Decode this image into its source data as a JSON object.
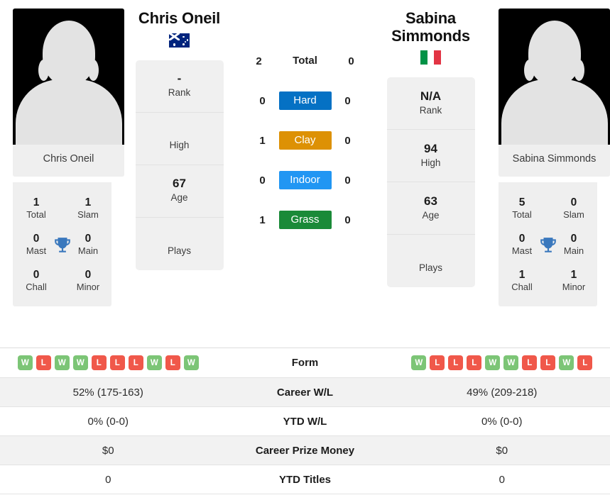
{
  "players": {
    "left": {
      "name": "Chris Oneil",
      "photo_caption": "Chris Oneil",
      "country": "Australia",
      "flag_icon": "flag-australia-icon",
      "info_cards": [
        {
          "value": "-",
          "label": "Rank"
        },
        {
          "value": "",
          "label": "High"
        },
        {
          "value": "67",
          "label": "Age"
        },
        {
          "value": "",
          "label": "Plays"
        }
      ],
      "titles": [
        {
          "value": "1",
          "label": "Total"
        },
        {
          "value": "1",
          "label": "Slam"
        },
        {
          "value": "0",
          "label": "Mast"
        },
        {
          "value": "0",
          "label": "Main"
        },
        {
          "value": "0",
          "label": "Chall"
        },
        {
          "value": "0",
          "label": "Minor"
        }
      ],
      "form": [
        "W",
        "L",
        "W",
        "W",
        "L",
        "L",
        "L",
        "W",
        "L",
        "W"
      ],
      "career_wl": "52% (175-163)",
      "ytd_wl": "0% (0-0)",
      "career_prize_money": "$0",
      "ytd_titles": "0"
    },
    "right": {
      "name": "Sabina Simmonds",
      "photo_caption": "Sabina Simmonds",
      "country": "Italy",
      "flag_icon": "flag-italy-icon",
      "info_cards": [
        {
          "value": "N/A",
          "label": "Rank"
        },
        {
          "value": "94",
          "label": "High"
        },
        {
          "value": "63",
          "label": "Age"
        },
        {
          "value": "",
          "label": "Plays"
        }
      ],
      "titles": [
        {
          "value": "5",
          "label": "Total"
        },
        {
          "value": "0",
          "label": "Slam"
        },
        {
          "value": "0",
          "label": "Mast"
        },
        {
          "value": "0",
          "label": "Main"
        },
        {
          "value": "1",
          "label": "Chall"
        },
        {
          "value": "1",
          "label": "Minor"
        }
      ],
      "form": [
        "W",
        "L",
        "L",
        "L",
        "W",
        "W",
        "L",
        "L",
        "W",
        "L"
      ],
      "career_wl": "49% (209-218)",
      "ytd_wl": "0% (0-0)",
      "career_prize_money": "$0",
      "ytd_titles": "0"
    }
  },
  "surfaces": [
    {
      "label": "Total",
      "left": "2",
      "right": "0",
      "color": ""
    },
    {
      "label": "Hard",
      "left": "0",
      "right": "0",
      "color": "#0571c4"
    },
    {
      "label": "Clay",
      "left": "1",
      "right": "0",
      "color": "#dd9104"
    },
    {
      "label": "Indoor",
      "left": "0",
      "right": "0",
      "color": "#2196f3"
    },
    {
      "label": "Grass",
      "left": "1",
      "right": "0",
      "color": "#1a8a38"
    }
  ],
  "table_rows": [
    {
      "label": "Form",
      "left": "",
      "right": ""
    },
    {
      "label": "Career W/L",
      "left": "52% (175-163)",
      "right": "49% (209-218)"
    },
    {
      "label": "YTD W/L",
      "left": "0% (0-0)",
      "right": "0% (0-0)"
    },
    {
      "label": "Career Prize Money",
      "left": "$0",
      "right": "$0"
    },
    {
      "label": "YTD Titles",
      "left": "0",
      "right": "0"
    }
  ],
  "colors": {
    "form_win": "#7cc576",
    "form_loss": "#f0584a",
    "trophy": "#3a78bd",
    "card_bg": "#f0f0f0",
    "row_alt_bg": "#f2f2f2"
  },
  "icons": {
    "trophy": "trophy-icon"
  }
}
